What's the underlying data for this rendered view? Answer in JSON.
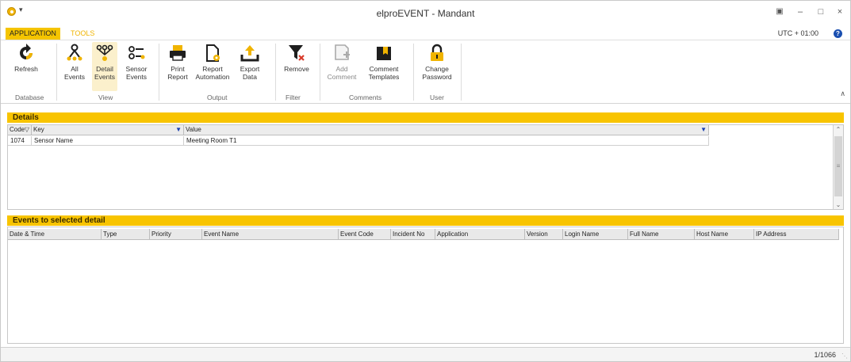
{
  "window": {
    "title": "elproEVENT - Mandant",
    "qa_menu": "▾",
    "minimize": "–",
    "maximize": "□",
    "close": "×",
    "restore_icon": "▣"
  },
  "tabs": {
    "application": "APPLICATION",
    "tools": "TOOLS"
  },
  "timezone": "UTC + 01:00",
  "help": "?",
  "ribbon": {
    "refresh": "Refresh",
    "all_events": "All\nEvents",
    "detail_events": "Detail\nEvents",
    "sensor_events": "Sensor\nEvents",
    "print_report": "Print\nReport",
    "report_automation": "Report\nAutomation",
    "export_data": "Export\nData",
    "remove": "Remove",
    "add_comment": "Add\nComment",
    "comment_templates": "Comment\nTemplates",
    "change_password": "Change\nPassword",
    "groups": {
      "database": "Database",
      "view": "View",
      "output": "Output",
      "filter": "Filter",
      "comments": "Comments",
      "user": "User"
    },
    "collapse": "∧"
  },
  "details": {
    "title": "Details",
    "columns": {
      "code": "Code",
      "key": "Key",
      "value": "Value"
    },
    "rows": [
      {
        "code": "1074",
        "key": "Sensor Name",
        "value": "Meeting Room T1"
      }
    ]
  },
  "events": {
    "title": "Events to selected detail",
    "columns": [
      "Date & Time",
      "Type",
      "Priority",
      "Event Name",
      "Event Code",
      "Incident No",
      "Application",
      "Version",
      "Login Name",
      "Full Name",
      "Host Name",
      "IP Address"
    ]
  },
  "status": {
    "count": "1/1066"
  }
}
